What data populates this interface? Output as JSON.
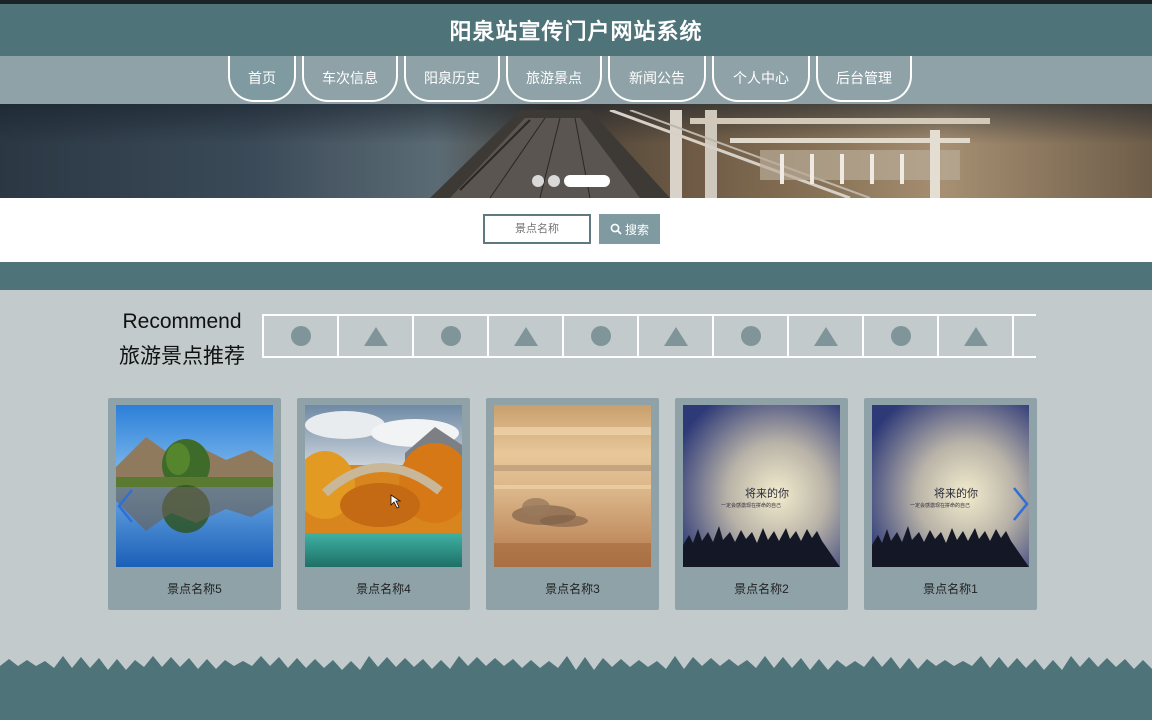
{
  "header": {
    "title": "阳泉站宣传门户网站系统"
  },
  "nav": {
    "items": [
      {
        "label": "首页"
      },
      {
        "label": "车次信息"
      },
      {
        "label": "阳泉历史"
      },
      {
        "label": "旅游景点"
      },
      {
        "label": "新闻公告"
      },
      {
        "label": "个人中心"
      },
      {
        "label": "后台管理"
      }
    ]
  },
  "banner": {
    "slide_count": 3,
    "active_slide": 3
  },
  "search": {
    "placeholder": "景点名称",
    "button_label": "搜索"
  },
  "recommend": {
    "title_en": "Recommend",
    "title_cn": "旅游景点推荐",
    "tab_icons": [
      "circle-icon",
      "triangle-icon",
      "circle-icon",
      "triangle-icon",
      "circle-icon",
      "triangle-icon",
      "circle-icon",
      "triangle-icon",
      "circle-icon",
      "triangle-icon"
    ]
  },
  "cards": [
    {
      "label": "景点名称5"
    },
    {
      "label": "景点名称4"
    },
    {
      "label": "景点名称3"
    },
    {
      "label": "景点名称2"
    },
    {
      "label": "景点名称1"
    }
  ],
  "card_image_text": {
    "line1": "将来的你",
    "line2": "一定会感激现在拼命的自己"
  },
  "colors": {
    "primary": "#4e7379",
    "nav_bg": "#8ea2a7",
    "card_bg": "#8ea2a7",
    "page_bg": "#c2cacb",
    "arrow": "#2f6fd6"
  }
}
